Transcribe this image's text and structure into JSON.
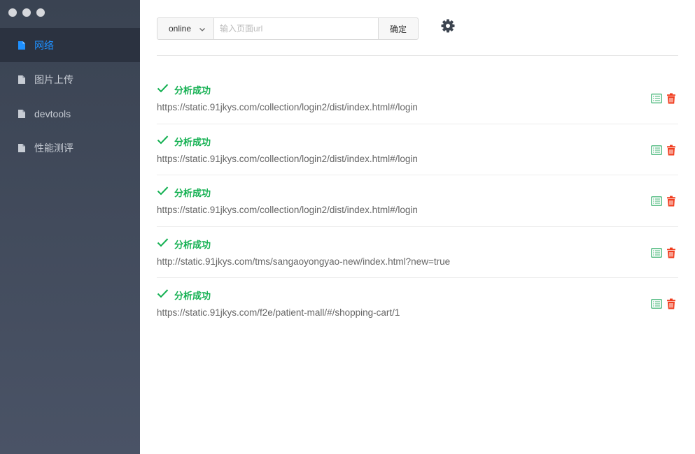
{
  "window": {
    "controls": [
      "close",
      "minimize",
      "maximize"
    ]
  },
  "sidebar": {
    "items": [
      {
        "label": "网络",
        "icon": "file-icon",
        "active": true
      },
      {
        "label": "图片上传",
        "icon": "file-icon",
        "active": false
      },
      {
        "label": "devtools",
        "icon": "file-icon",
        "active": false
      },
      {
        "label": "性能测评",
        "icon": "file-icon",
        "active": false
      }
    ]
  },
  "toolbar": {
    "env_select": {
      "value": "online",
      "icon": "chevron-down-icon"
    },
    "url_input": {
      "placeholder": "输入页面url",
      "value": ""
    },
    "confirm_label": "确定",
    "settings_icon": "gear-icon"
  },
  "results": [
    {
      "status": "分析成功",
      "url": "https://static.91jkys.com/collection/login2/dist/index.html#/login"
    },
    {
      "status": "分析成功",
      "url": "https://static.91jkys.com/collection/login2/dist/index.html#/login"
    },
    {
      "status": "分析成功",
      "url": "https://static.91jkys.com/collection/login2/dist/index.html#/login"
    },
    {
      "status": "分析成功",
      "url": "http://static.91jkys.com/tms/sangaoyongyao-new/index.html?new=true"
    },
    {
      "status": "分析成功",
      "url": "https://static.91jkys.com/f2e/patient-mall/#/shopping-cart/1"
    }
  ],
  "colors": {
    "sidebar_bg": "#434b5b",
    "sidebar_active_bg": "#2b3240",
    "active_text": "#1e90ff",
    "success": "#13b051",
    "detail_icon": "#3cb371",
    "delete_icon": "#f03c1e"
  }
}
